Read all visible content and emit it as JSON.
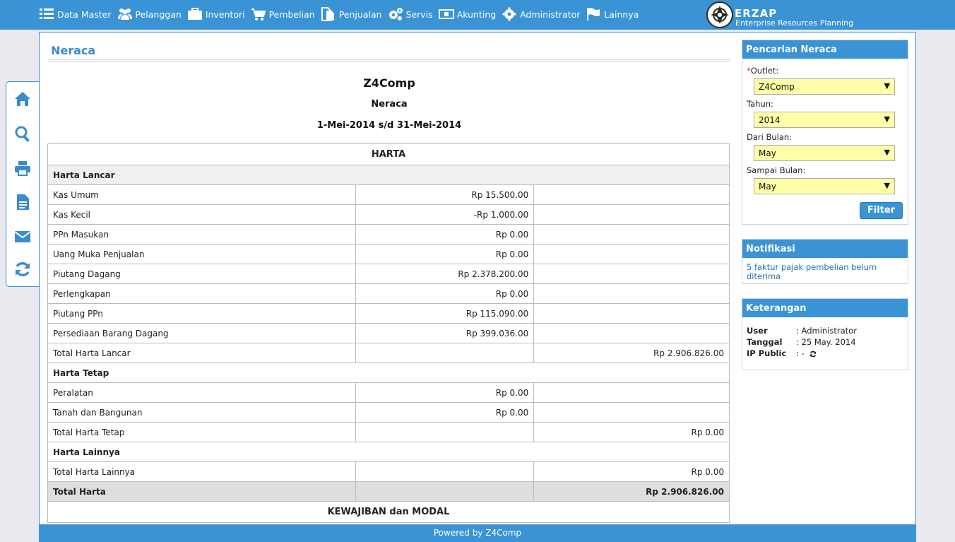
{
  "nav": [
    {
      "label": "Data Master",
      "icon": "list-icon"
    },
    {
      "label": "Pelanggan",
      "icon": "users-icon"
    },
    {
      "label": "Inventori",
      "icon": "briefcase-icon"
    },
    {
      "label": "Pembelian",
      "icon": "cart-icon"
    },
    {
      "label": "Penjualan",
      "icon": "document-icon"
    },
    {
      "label": "Servis",
      "icon": "gears-icon"
    },
    {
      "label": "Akunting",
      "icon": "money-icon"
    },
    {
      "label": "Administrator",
      "icon": "gear-icon"
    },
    {
      "label": "Lainnya",
      "icon": "flag-icon"
    }
  ],
  "logo": {
    "title": "ERZAP",
    "subtitle": "Enterprise Resources Planning"
  },
  "side_tools": [
    "home-icon",
    "search-icon",
    "print-icon",
    "file-icon",
    "mail-icon",
    "refresh-icon"
  ],
  "page": {
    "title": "Neraca",
    "company": "Z4Comp",
    "report_name": "Neraca",
    "period": "1-Mei-2014 s/d 31-Mei-2014"
  },
  "report": {
    "section_assets": "HARTA",
    "group_current": "Harta Lancar",
    "current_rows": [
      {
        "name": "Kas Umum",
        "amount": "Rp 15.500.00"
      },
      {
        "name": "Kas Kecil",
        "amount": "-Rp 1.000.00"
      },
      {
        "name": "PPn Masukan",
        "amount": "Rp 0.00"
      },
      {
        "name": "Uang Muka Penjualan",
        "amount": "Rp 0.00"
      },
      {
        "name": "Piutang Dagang",
        "amount": "Rp 2.378.200.00"
      },
      {
        "name": "Perlengkapan",
        "amount": "Rp 0.00"
      },
      {
        "name": "Piutang PPn",
        "amount": "Rp 115.090.00"
      },
      {
        "name": "Persediaan Barang Dagang",
        "amount": "Rp 399.036.00"
      }
    ],
    "total_current_label": "Total Harta Lancar",
    "total_current": "Rp 2.906.826.00",
    "group_fixed": "Harta Tetap",
    "fixed_rows": [
      {
        "name": "Peralatan",
        "amount": "Rp 0.00"
      },
      {
        "name": "Tanah dan Bangunan",
        "amount": "Rp 0.00"
      }
    ],
    "total_fixed_label": "Total Harta Tetap",
    "total_fixed": "Rp 0.00",
    "group_other": "Harta Lainnya",
    "total_other_label": "Total Harta Lainnya",
    "total_other": "Rp 0.00",
    "grand_label": "Total Harta",
    "grand_total": "Rp 2.906.826.00",
    "section_liabilities": "KEWAJIBAN dan MODAL"
  },
  "search_panel": {
    "title": "Pencarian Neraca",
    "required_mark": "*",
    "outlet_label": "Outlet:",
    "outlet_value": "Z4Comp",
    "year_label": "Tahun:",
    "year_value": "2014",
    "from_month_label": "Dari Bulan:",
    "from_month_value": "May",
    "to_month_label": "Sampai Bulan:",
    "to_month_value": "May",
    "filter_label": "Filter"
  },
  "notif_panel": {
    "title": "Notifikasi",
    "message": "5 faktur pajak pembelian belum diterima"
  },
  "info_panel": {
    "title": "Keterangan",
    "user_label": "User",
    "user_value": ": Administrator",
    "date_label": "Tanggal",
    "date_value": ": 25 May. 2014",
    "ip_label": "IP Public",
    "ip_value": ": -"
  },
  "footer": {
    "text": "Powered by Z4Comp"
  },
  "colors": {
    "accent": "#3a93d5",
    "select_bg": "#ffffa8",
    "link": "#2a6fb0"
  }
}
